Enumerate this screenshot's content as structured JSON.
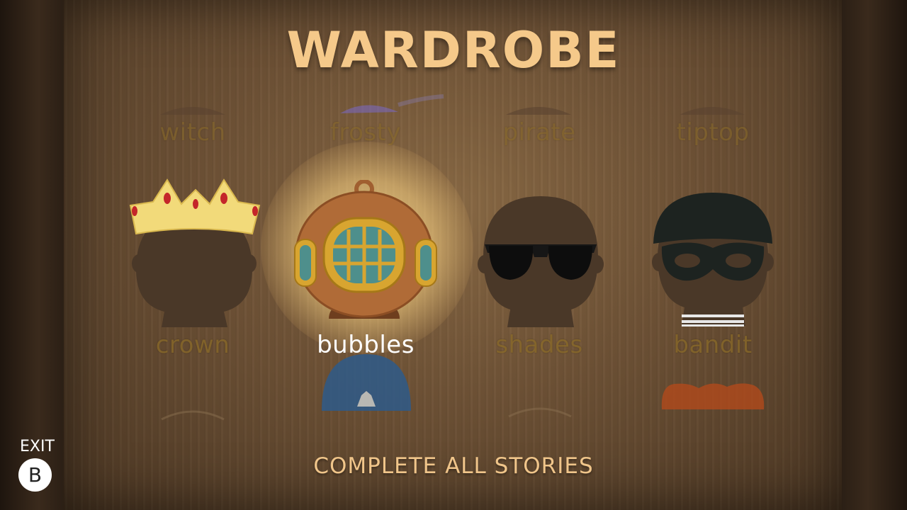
{
  "title": "WARDROBE",
  "rows": [
    {
      "items": [
        {
          "label": "witch",
          "icon": "witch-hat-icon"
        },
        {
          "label": "frosty",
          "icon": "frosty-hat-icon"
        },
        {
          "label": "pirate",
          "icon": "pirate-hat-icon"
        },
        {
          "label": "tiptop",
          "icon": "tophat-icon"
        }
      ]
    },
    {
      "items": [
        {
          "label": "crown",
          "icon": "crown-icon"
        },
        {
          "label": "bubbles",
          "icon": "diving-helmet-icon",
          "selected": true
        },
        {
          "label": "shades",
          "icon": "sunglasses-icon"
        },
        {
          "label": "bandit",
          "icon": "bandit-mask-icon"
        }
      ]
    }
  ],
  "footer": "COMPLETE ALL STORIES",
  "exit": {
    "label": "EXIT",
    "button": "B"
  },
  "colors": {
    "title": "#f5c98a",
    "label_dim": "#8a6a28",
    "label_selected": "#ffffff"
  }
}
